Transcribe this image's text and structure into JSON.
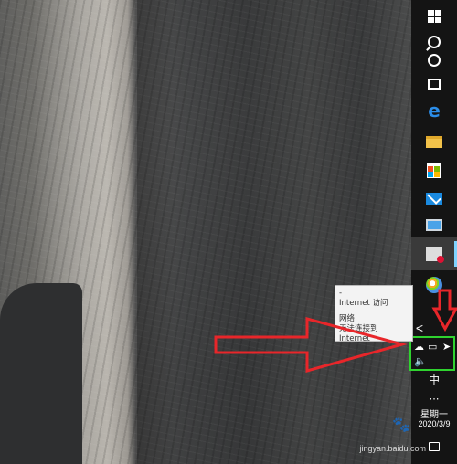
{
  "taskbar": {
    "items": [
      {
        "name": "start",
        "icon": "windows-logo-icon"
      },
      {
        "name": "search",
        "icon": "search-icon"
      },
      {
        "name": "cortana",
        "icon": "cortana-ring-icon"
      },
      {
        "name": "task-view",
        "icon": "task-view-icon"
      },
      {
        "name": "edge",
        "icon": "edge-browser-icon",
        "glyph": "e"
      },
      {
        "name": "file-explorer",
        "icon": "folder-icon"
      },
      {
        "name": "store",
        "icon": "store-icon"
      },
      {
        "name": "mail",
        "icon": "mail-icon"
      },
      {
        "name": "this-pc",
        "icon": "computer-icon"
      },
      {
        "name": "snipping-tool",
        "icon": "snip-icon"
      },
      {
        "name": "paint",
        "icon": "paint-icon"
      }
    ],
    "tray": {
      "chevron": "<",
      "ime_label": "中",
      "overflow": "⋯",
      "weekday": "星期一",
      "date": "2020/3/9"
    }
  },
  "tooltip": {
    "line1": "-",
    "line2": "Internet 访问",
    "line3": "网络",
    "line4": "无法连接到 Internet"
  },
  "watermark": {
    "logo": "Bai 百",
    "text": "jingyan.baidu.com"
  },
  "colors": {
    "taskbar_bg": "#141414",
    "highlight_box": "#2fd32f",
    "annotation_arrow": "#e8262a",
    "tooltip_bg": "#f3f3f3"
  }
}
